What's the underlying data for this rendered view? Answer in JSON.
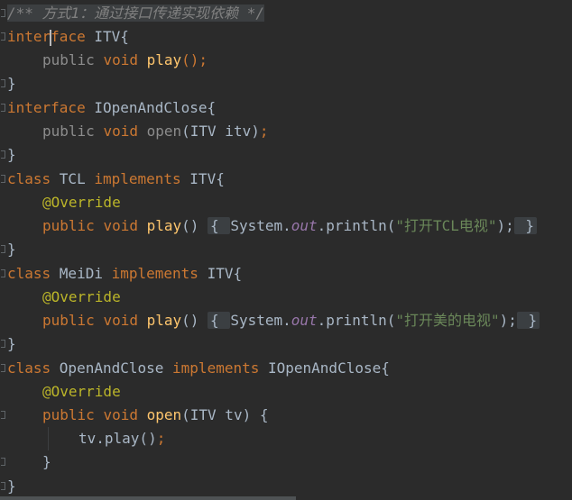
{
  "editor": {
    "lines": [
      {
        "tokens": [
          {
            "t": "/** 方式1：通过接口传递实现依赖 */",
            "c": "comment comment-bg"
          }
        ],
        "indent": 0
      },
      {
        "tokens": [
          {
            "t": "inter",
            "c": "kw"
          },
          {
            "t": "",
            "c": "caret"
          },
          {
            "t": "face",
            "c": "kw"
          },
          {
            "t": " ITV{",
            "c": ""
          }
        ],
        "indent": 0
      },
      {
        "tokens": [
          {
            "t": "public ",
            "c": "muted"
          },
          {
            "t": "void ",
            "c": "kw"
          },
          {
            "t": "play",
            "c": "fn"
          },
          {
            "t": "();",
            "c": "kw"
          }
        ],
        "indent": 1
      },
      {
        "tokens": [
          {
            "t": "}",
            "c": ""
          }
        ],
        "indent": 0
      },
      {
        "tokens": [
          {
            "t": "interface ",
            "c": "kw"
          },
          {
            "t": "IOpenAndClose{",
            "c": ""
          }
        ],
        "indent": 0
      },
      {
        "tokens": [
          {
            "t": "public ",
            "c": "muted"
          },
          {
            "t": "void ",
            "c": "kw"
          },
          {
            "t": "open",
            "c": "muted"
          },
          {
            "t": "(ITV itv)",
            "c": ""
          },
          {
            "t": ";",
            "c": "kw"
          }
        ],
        "indent": 1
      },
      {
        "tokens": [
          {
            "t": "}",
            "c": ""
          }
        ],
        "indent": 0
      },
      {
        "tokens": [
          {
            "t": "class ",
            "c": "kw"
          },
          {
            "t": "TCL ",
            "c": ""
          },
          {
            "t": "implements ",
            "c": "kw"
          },
          {
            "t": "ITV{",
            "c": ""
          }
        ],
        "indent": 0
      },
      {
        "tokens": [
          {
            "t": "@Override",
            "c": "ann"
          }
        ],
        "indent": 1
      },
      {
        "tokens": [
          {
            "t": "public ",
            "c": "kw"
          },
          {
            "t": "void ",
            "c": "kw"
          },
          {
            "t": "play",
            "c": "fn"
          },
          {
            "t": "() ",
            "c": ""
          },
          {
            "t": "{ ",
            "c": "folded"
          },
          {
            "t": "System.",
            "c": ""
          },
          {
            "t": "out",
            "c": "static"
          },
          {
            "t": ".println(",
            "c": ""
          },
          {
            "t": "\"打开TCL电视\"",
            "c": "str"
          },
          {
            "t": ");",
            "c": ""
          },
          {
            "t": " }",
            "c": "folded"
          }
        ],
        "indent": 1
      },
      {
        "tokens": [
          {
            "t": "}",
            "c": ""
          }
        ],
        "indent": 0
      },
      {
        "tokens": [
          {
            "t": "class ",
            "c": "kw"
          },
          {
            "t": "MeiDi ",
            "c": ""
          },
          {
            "t": "implements ",
            "c": "kw"
          },
          {
            "t": "ITV{",
            "c": ""
          }
        ],
        "indent": 0
      },
      {
        "tokens": [
          {
            "t": "@Override",
            "c": "ann"
          }
        ],
        "indent": 1
      },
      {
        "tokens": [
          {
            "t": "public ",
            "c": "kw"
          },
          {
            "t": "void ",
            "c": "kw"
          },
          {
            "t": "play",
            "c": "fn"
          },
          {
            "t": "() ",
            "c": ""
          },
          {
            "t": "{ ",
            "c": "folded"
          },
          {
            "t": "System.",
            "c": ""
          },
          {
            "t": "out",
            "c": "static"
          },
          {
            "t": ".println(",
            "c": ""
          },
          {
            "t": "\"打开美的电视\"",
            "c": "str"
          },
          {
            "t": ");",
            "c": ""
          },
          {
            "t": " }",
            "c": "folded"
          }
        ],
        "indent": 1
      },
      {
        "tokens": [
          {
            "t": "}",
            "c": ""
          }
        ],
        "indent": 0
      },
      {
        "tokens": [
          {
            "t": "class ",
            "c": "kw"
          },
          {
            "t": "OpenAndClose ",
            "c": ""
          },
          {
            "t": "implements ",
            "c": "kw"
          },
          {
            "t": "IOpenAndClose{",
            "c": ""
          }
        ],
        "indent": 0
      },
      {
        "tokens": [
          {
            "t": "@Override",
            "c": "ann"
          }
        ],
        "indent": 1
      },
      {
        "tokens": [
          {
            "t": "public ",
            "c": "kw"
          },
          {
            "t": "void ",
            "c": "kw"
          },
          {
            "t": "open",
            "c": "fn"
          },
          {
            "t": "(ITV tv) {",
            "c": ""
          }
        ],
        "indent": 1
      },
      {
        "tokens": [
          {
            "t": "tv.play()",
            "c": ""
          },
          {
            "t": ";",
            "c": "kw"
          }
        ],
        "indent": 2
      },
      {
        "tokens": [
          {
            "t": "}",
            "c": ""
          }
        ],
        "indent": 1
      },
      {
        "tokens": [
          {
            "t": "}",
            "c": ""
          }
        ],
        "indent": 0
      }
    ]
  }
}
